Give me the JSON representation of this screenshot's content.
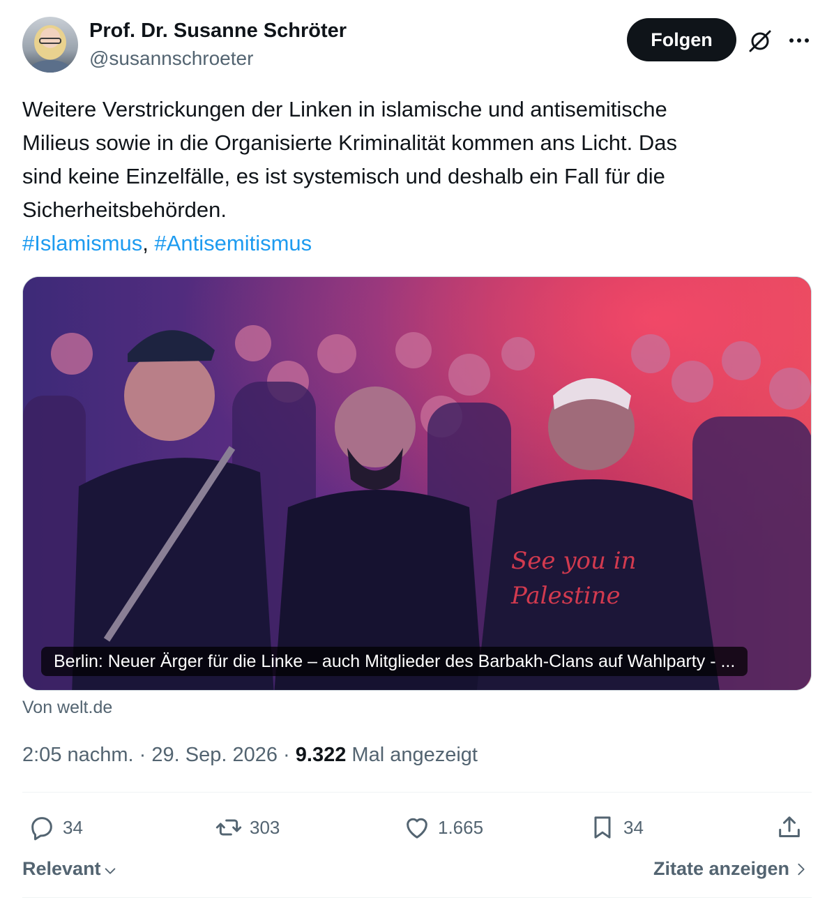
{
  "author": {
    "name": "Prof. Dr. Susanne Schröter",
    "handle": "@susannschroeter",
    "follow_label": "Folgen"
  },
  "tweet": {
    "lines": [
      "Weitere Verstrickungen der Linken in islamische und antisemitische",
      "Milieus sowie in die Organisierte Kriminalität kommen ans Licht. Das",
      "sind keine Einzelfälle, es ist systemisch und deshalb ein Fall für die",
      "Sicherheitsbehörden."
    ],
    "hashtag_1": "#Islamismus",
    "separator": ", ",
    "hashtag_2": "#Antisemitismus"
  },
  "card": {
    "caption": "Berlin: Neuer Ärger für die Linke – auch Mitglieder des Barbakh-Clans auf Wahlparty - ...",
    "shirt_text_1": "See you in",
    "shirt_text_2": "Palestine",
    "source": "Von welt.de"
  },
  "meta": {
    "time": "2:05 nachm.",
    "dot": " · ",
    "date": "29. Sep. 2026",
    "views": "9.322",
    "views_label": "Mal angezeigt"
  },
  "actions": {
    "replies": "34",
    "reposts": "303",
    "likes": "1.665",
    "bookmarks": "34"
  },
  "footer": {
    "sort_label": "Relevant",
    "quotes_label": "Zitate anzeigen"
  },
  "icons": [
    "grok-icon",
    "more-icon",
    "reply-icon",
    "repost-icon",
    "like-icon",
    "bookmark-icon",
    "share-icon",
    "chevron-down-icon",
    "chevron-right-icon"
  ],
  "colors": {
    "link": "#1d9bf0",
    "text": "#0f1419",
    "secondary": "#536471",
    "follow_bg": "#0f1419"
  }
}
